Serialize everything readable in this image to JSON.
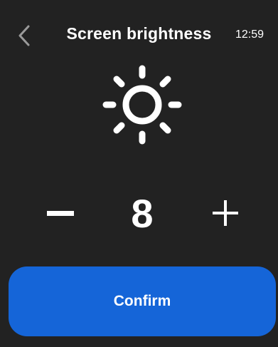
{
  "header": {
    "title": "Screen brightness",
    "time": "12:59"
  },
  "brightness": {
    "value": "8"
  },
  "confirm_label": "Confirm",
  "icons": {
    "back": "chevron-left-icon",
    "brightness": "sun-icon",
    "decrease": "minus-icon",
    "increase": "plus-icon"
  },
  "colors": {
    "background": "#222222",
    "accent": "#1565d8",
    "text": "#ffffff",
    "icon_muted": "#9a9a9a"
  }
}
